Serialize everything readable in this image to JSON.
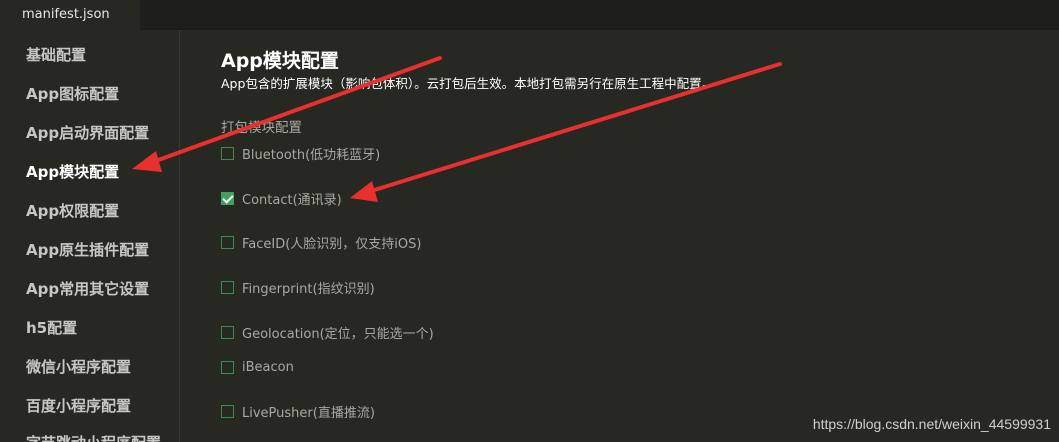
{
  "tab": {
    "label": "manifest.json"
  },
  "sidebar": {
    "items": [
      {
        "label": "基础配置"
      },
      {
        "label": "App图标配置"
      },
      {
        "label": "App启动界面配置"
      },
      {
        "label": "App模块配置",
        "active": true
      },
      {
        "label": "App权限配置"
      },
      {
        "label": "App原生插件配置"
      },
      {
        "label": "App常用其它设置"
      },
      {
        "label": "h5配置"
      },
      {
        "label": "微信小程序配置"
      },
      {
        "label": "百度小程序配置"
      },
      {
        "label": "字节跳动小程序配置"
      }
    ]
  },
  "main": {
    "title": "App模块配置",
    "description": "App包含的扩展模块（影响包体积）。云打包后生效。本地打包需另行在原生工程中配置。",
    "section_label": "打包模块配置",
    "options": [
      {
        "label": "Bluetooth(低功耗蓝牙)",
        "checked": false
      },
      {
        "label": "Contact(通讯录)",
        "checked": true
      },
      {
        "label": "FaceID(人脸识别，仅支持iOS)",
        "checked": false
      },
      {
        "label": "Fingerprint(指纹识别)",
        "checked": false
      },
      {
        "label": "Geolocation(定位，只能选一个)",
        "checked": false
      },
      {
        "label": "iBeacon",
        "checked": false
      },
      {
        "label": "LivePusher(直播推流)",
        "checked": false
      }
    ]
  },
  "watermark": "https://blog.csdn.net/weixin_44599931",
  "colors": {
    "annotation_arrow": "#e8302f",
    "checkbox_checked": "#3fa15a",
    "background": "#272822"
  }
}
